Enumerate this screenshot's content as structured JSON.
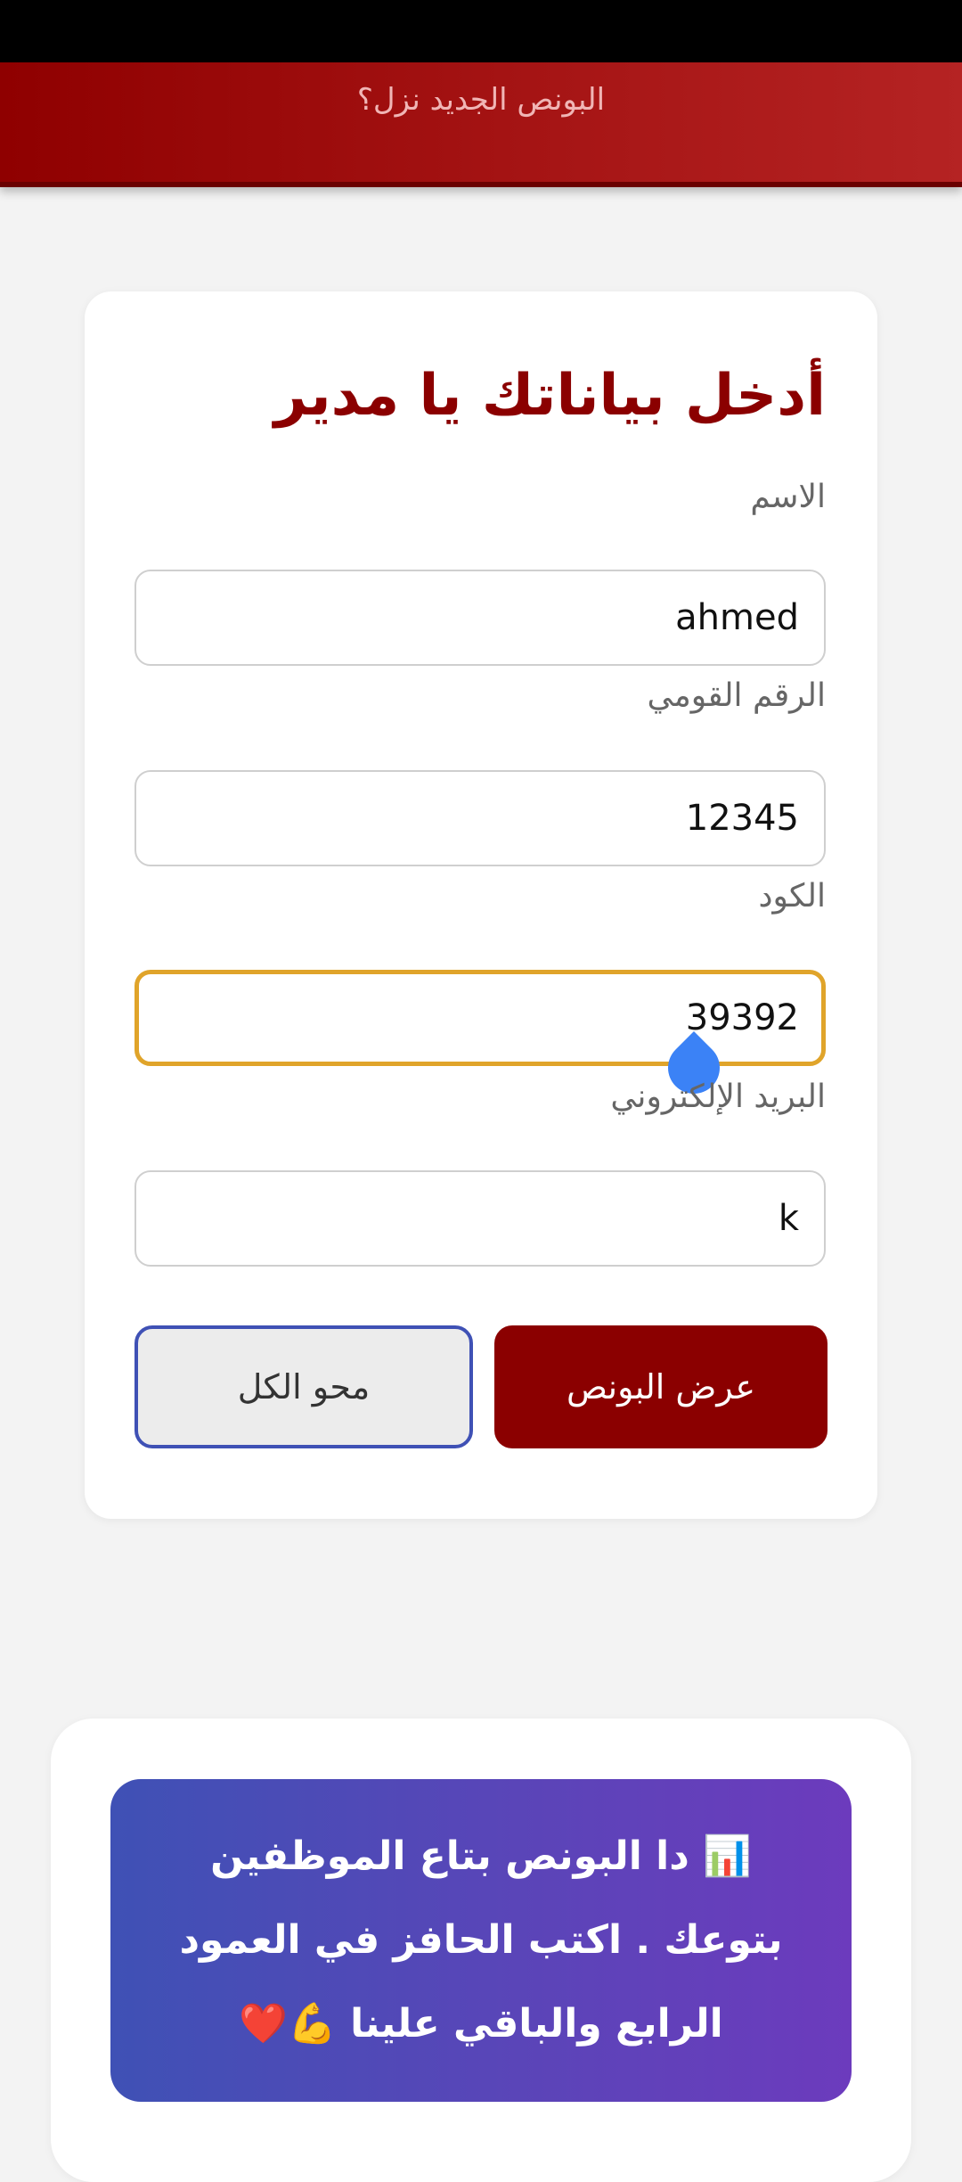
{
  "banner": {
    "text": "البونص الجديد نزل؟"
  },
  "form": {
    "title": "أدخل بياناتك يا مدير",
    "fields": [
      {
        "label": "الاسم",
        "value": "ahmed"
      },
      {
        "label": "الرقم القومي",
        "value": "12345"
      },
      {
        "label": "الكود",
        "value": "39392"
      },
      {
        "label": "البريد الإلكتروني",
        "value": "k"
      }
    ],
    "show_bonus_label": "عرض البونص",
    "clear_all_label": "محو الكل"
  },
  "info": {
    "text": "📊 دا البونص بتاع الموظفين بتوعك . اكتب الحافز في العمود الرابع والباقي علينا 💪❤️"
  },
  "colors": {
    "primary": "#8b0000",
    "focus": "#e0a42a",
    "accent_blue": "#3f51b5",
    "info_gradient_end": "#6c3bbd",
    "cursor_handle": "#3b82f6"
  }
}
